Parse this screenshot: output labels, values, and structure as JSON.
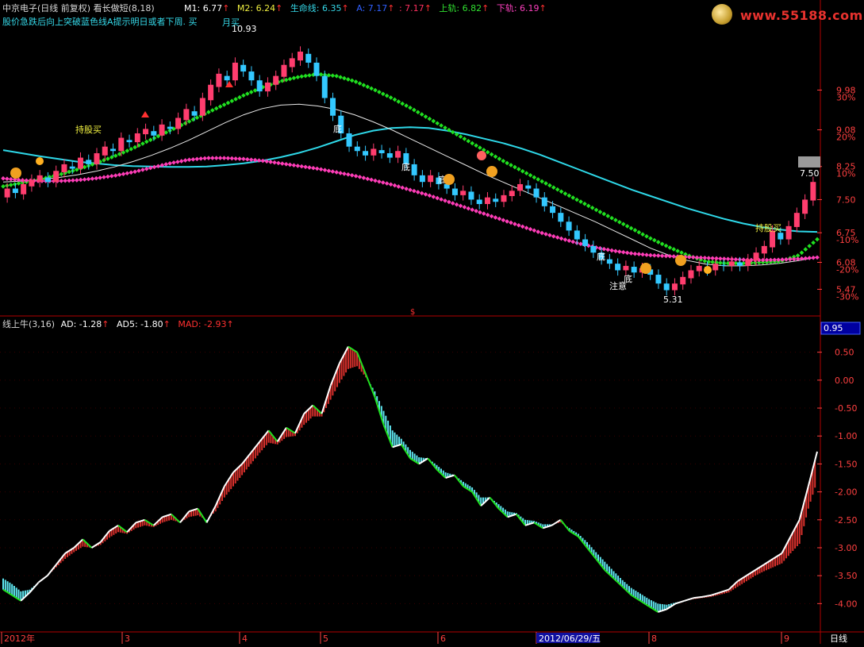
{
  "header": {
    "stock_title": "中京电子(日线 前复权)",
    "indicator_name": "看长做短(8,18)",
    "m1": "M1: 6.77",
    "m2": "M2: 6.24",
    "lifeline": "生命线: 6.35",
    "a_line": "A: 7.17",
    "b_line": ": 7.17",
    "upper": "上轨: 6.82",
    "lower": "下轨: 6.19",
    "hint": "股价急跌后向上突破蓝色线A提示明日或者下周.",
    "hint_tag": "买"
  },
  "lower_header": {
    "name": "线上牛(3,16)",
    "ad": "AD: -1.28",
    "ad5": "AD5: -1.80",
    "mad": "MAD: -2.93",
    "current_value": "0.95"
  },
  "watermark": {
    "text": "www.55188.com"
  },
  "colors": {
    "candle_up": "#ff3d6e",
    "candle_down": "#33c8ff",
    "ma_cyan": "#2ed8e8",
    "ma_white": "#e8e8e8",
    "dots_green": "#20e020",
    "dots_pink": "#ff3db8",
    "red": "#d8302c",
    "cyan_bar": "#5ee6f0",
    "axis": "#b00000",
    "tick": "#ff4040"
  },
  "chart_data": [
    {
      "type": "candlestick",
      "yaxis": {
        "price_ticks": [
          "9.98",
          "9.08",
          "8.25",
          "7.50",
          "6.75",
          "6.08",
          "5.47"
        ],
        "pct_ticks": [
          "30%",
          "20%",
          "10%",
          "-10%",
          "-20%",
          "-30%"
        ],
        "ylim": [
          5.1,
          11.3
        ]
      },
      "annotations": {
        "high": "10.93",
        "low": "5.31",
        "last": "7.50",
        "bottom_marks": [
          "底",
          "底",
          "底",
          "底",
          "底"
        ],
        "attention": "注意",
        "buy_left": "持股买",
        "buy_right": "持股买",
        "month_buy": "月买"
      },
      "x_months": [
        "2012年",
        "3",
        "4",
        "5",
        "6",
        "2012/06/29/五",
        "8",
        "9"
      ],
      "candles": [
        {
          "o": 7.55,
          "c": 7.75
        },
        {
          "o": 7.75,
          "c": 7.65
        },
        {
          "o": 7.62,
          "c": 7.85
        },
        {
          "o": 7.8,
          "c": 7.95
        },
        {
          "o": 7.9,
          "c": 8.05
        },
        {
          "o": 8.0,
          "c": 7.9
        },
        {
          "o": 7.9,
          "c": 8.15
        },
        {
          "o": 8.12,
          "c": 8.3
        },
        {
          "o": 8.25,
          "c": 8.2
        },
        {
          "o": 8.2,
          "c": 8.45
        },
        {
          "o": 8.4,
          "c": 8.3
        },
        {
          "o": 8.3,
          "c": 8.55
        },
        {
          "o": 8.5,
          "c": 8.7
        },
        {
          "o": 8.65,
          "c": 8.6
        },
        {
          "o": 8.6,
          "c": 8.9
        },
        {
          "o": 8.85,
          "c": 8.8
        },
        {
          "o": 8.8,
          "c": 9.0
        },
        {
          "o": 8.98,
          "c": 9.1
        },
        {
          "o": 9.05,
          "c": 8.95
        },
        {
          "o": 8.95,
          "c": 9.2
        },
        {
          "o": 9.15,
          "c": 9.1
        },
        {
          "o": 9.1,
          "c": 9.35
        },
        {
          "o": 9.3,
          "c": 9.55
        },
        {
          "o": 9.5,
          "c": 9.4
        },
        {
          "o": 9.4,
          "c": 9.8
        },
        {
          "o": 9.75,
          "c": 10.1
        },
        {
          "o": 10.05,
          "c": 10.35
        },
        {
          "o": 10.3,
          "c": 10.2
        },
        {
          "o": 10.2,
          "c": 10.6
        },
        {
          "o": 10.55,
          "c": 10.4
        },
        {
          "o": 10.4,
          "c": 10.2
        },
        {
          "o": 10.2,
          "c": 9.95
        },
        {
          "o": 9.95,
          "c": 10.15
        },
        {
          "o": 10.1,
          "c": 10.3
        },
        {
          "o": 10.28,
          "c": 10.55
        },
        {
          "o": 10.5,
          "c": 10.7
        },
        {
          "o": 10.65,
          "c": 10.85
        },
        {
          "o": 10.8,
          "c": 10.6
        },
        {
          "o": 10.6,
          "c": 10.3
        },
        {
          "o": 10.3,
          "c": 9.8
        },
        {
          "o": 9.8,
          "c": 9.4
        },
        {
          "o": 9.4,
          "c": 9.0
        },
        {
          "o": 9.0,
          "c": 8.7
        },
        {
          "o": 8.7,
          "c": 8.6
        },
        {
          "o": 8.6,
          "c": 8.5
        },
        {
          "o": 8.5,
          "c": 8.65
        },
        {
          "o": 8.62,
          "c": 8.55
        },
        {
          "o": 8.55,
          "c": 8.45
        },
        {
          "o": 8.45,
          "c": 8.6
        },
        {
          "o": 8.55,
          "c": 8.3
        },
        {
          "o": 8.3,
          "c": 8.05
        },
        {
          "o": 8.05,
          "c": 7.9
        },
        {
          "o": 7.9,
          "c": 8.05
        },
        {
          "o": 8.0,
          "c": 7.85
        },
        {
          "o": 7.85,
          "c": 7.75
        },
        {
          "o": 7.75,
          "c": 7.6
        },
        {
          "o": 7.6,
          "c": 7.7
        },
        {
          "o": 7.68,
          "c": 7.5
        },
        {
          "o": 7.5,
          "c": 7.4
        },
        {
          "o": 7.4,
          "c": 7.55
        },
        {
          "o": 7.52,
          "c": 7.45
        },
        {
          "o": 7.45,
          "c": 7.6
        },
        {
          "o": 7.58,
          "c": 7.7
        },
        {
          "o": 7.7,
          "c": 7.85
        },
        {
          "o": 7.82,
          "c": 7.75
        },
        {
          "o": 7.75,
          "c": 7.55
        },
        {
          "o": 7.55,
          "c": 7.35
        },
        {
          "o": 7.35,
          "c": 7.2
        },
        {
          "o": 7.2,
          "c": 7.0
        },
        {
          "o": 7.0,
          "c": 6.8
        },
        {
          "o": 6.8,
          "c": 6.6
        },
        {
          "o": 6.6,
          "c": 6.45
        },
        {
          "o": 6.45,
          "c": 6.3
        },
        {
          "o": 6.3,
          "c": 6.15
        },
        {
          "o": 6.15,
          "c": 6.05
        },
        {
          "o": 6.05,
          "c": 5.9
        },
        {
          "o": 5.9,
          "c": 6.0
        },
        {
          "o": 5.98,
          "c": 5.85
        },
        {
          "o": 5.85,
          "c": 5.95
        },
        {
          "o": 5.92,
          "c": 5.8
        },
        {
          "o": 5.8,
          "c": 5.6
        },
        {
          "o": 5.6,
          "c": 5.45
        },
        {
          "o": 5.45,
          "c": 5.6
        },
        {
          "o": 5.58,
          "c": 5.75
        },
        {
          "o": 5.72,
          "c": 5.9
        },
        {
          "o": 5.88,
          "c": 6.0
        },
        {
          "o": 5.98,
          "c": 5.9
        },
        {
          "o": 5.9,
          "c": 6.05
        },
        {
          "o": 6.02,
          "c": 6.0
        },
        {
          "o": 6.0,
          "c": 6.1
        },
        {
          "o": 6.08,
          "c": 6.0
        },
        {
          "o": 6.0,
          "c": 6.15
        },
        {
          "o": 6.12,
          "c": 6.3
        },
        {
          "o": 6.28,
          "c": 6.45
        },
        {
          "o": 6.42,
          "c": 6.8
        },
        {
          "o": 6.75,
          "c": 6.6
        },
        {
          "o": 6.6,
          "c": 6.9
        },
        {
          "o": 6.88,
          "c": 7.2
        },
        {
          "o": 7.18,
          "c": 7.5
        },
        {
          "o": 7.48,
          "c": 7.9
        }
      ],
      "ma_cyan": [
        8.62,
        8.55,
        8.48,
        8.42,
        8.36,
        8.32,
        8.28,
        8.26,
        8.25,
        8.24,
        8.24,
        8.25,
        8.28,
        8.32,
        8.38,
        8.46,
        8.56,
        8.68,
        8.82,
        8.96,
        9.06,
        9.12,
        9.14,
        9.12,
        9.06,
        8.98,
        8.88,
        8.78,
        8.66,
        8.52,
        8.36,
        8.2,
        8.04,
        7.88,
        7.72,
        7.58,
        7.44,
        7.3,
        7.18,
        7.06,
        6.96,
        6.88,
        6.82,
        6.78,
        6.77
      ],
      "ma_white": [
        7.9,
        7.92,
        7.95,
        8.0,
        8.06,
        8.14,
        8.24,
        8.36,
        8.5,
        8.66,
        8.84,
        9.04,
        9.24,
        9.42,
        9.56,
        9.64,
        9.66,
        9.62,
        9.54,
        9.42,
        9.26,
        9.08,
        8.88,
        8.68,
        8.48,
        8.28,
        8.08,
        7.9,
        7.72,
        7.54,
        7.36,
        7.18,
        7.0,
        6.8,
        6.6,
        6.4,
        6.24,
        6.12,
        6.04,
        6.0,
        6.0,
        6.02,
        6.06,
        6.12,
        6.2
      ],
      "dots_green": [
        7.8,
        7.88,
        7.96,
        8.06,
        8.18,
        8.32,
        8.48,
        8.66,
        8.86,
        9.06,
        9.26,
        9.46,
        9.66,
        9.86,
        10.04,
        10.18,
        10.28,
        10.34,
        10.3,
        10.18,
        10.0,
        9.8,
        9.58,
        9.34,
        9.1,
        8.86,
        8.62,
        8.38,
        8.16,
        7.94,
        7.72,
        7.5,
        7.28,
        7.06,
        6.84,
        6.62,
        6.42,
        6.24,
        6.1,
        6.06,
        6.06,
        6.08,
        6.1,
        6.24,
        6.6
      ],
      "dots_pink": [
        7.98,
        7.94,
        7.92,
        7.92,
        7.94,
        7.98,
        8.04,
        8.12,
        8.22,
        8.32,
        8.4,
        8.44,
        8.44,
        8.42,
        8.38,
        8.32,
        8.26,
        8.2,
        8.12,
        8.04,
        7.94,
        7.84,
        7.72,
        7.6,
        7.46,
        7.32,
        7.18,
        7.04,
        6.9,
        6.76,
        6.64,
        6.52,
        6.42,
        6.34,
        6.28,
        6.24,
        6.22,
        6.2,
        6.18,
        6.16,
        6.14,
        6.13,
        6.14,
        6.16,
        6.19
      ]
    },
    {
      "type": "bar",
      "title": "线上牛(3,16)",
      "yaxis": {
        "ticks": [
          "0.50",
          "0.00",
          "-0.50",
          "-1.00",
          "-1.50",
          "-2.00",
          "-2.50",
          "-3.00",
          "-3.50",
          "-4.00"
        ],
        "ylim": [
          -4.45,
          0.95
        ]
      },
      "series_ad": [
        -3.75,
        -3.85,
        -3.95,
        -3.8,
        -3.62,
        -3.5,
        -3.3,
        -3.1,
        -3.0,
        -2.85,
        -3.0,
        -2.9,
        -2.7,
        -2.6,
        -2.72,
        -2.55,
        -2.5,
        -2.6,
        -2.45,
        -2.4,
        -2.55,
        -2.35,
        -2.3,
        -2.55,
        -2.25,
        -1.9,
        -1.65,
        -1.5,
        -1.3,
        -1.1,
        -0.9,
        -1.1,
        -0.85,
        -0.95,
        -0.6,
        -0.45,
        -0.6,
        -0.1,
        0.3,
        0.6,
        0.5,
        0.1,
        -0.3,
        -0.8,
        -1.2,
        -1.15,
        -1.4,
        -1.5,
        -1.4,
        -1.6,
        -1.75,
        -1.7,
        -1.9,
        -2.0,
        -2.25,
        -2.1,
        -2.3,
        -2.45,
        -2.4,
        -2.6,
        -2.55,
        -2.65,
        -2.6,
        -2.5,
        -2.7,
        -2.8,
        -3.0,
        -3.2,
        -3.4,
        -3.55,
        -3.7,
        -3.85,
        -3.95,
        -4.05,
        -4.15,
        -4.1,
        -4.0,
        -3.95,
        -3.9,
        -3.88,
        -3.85,
        -3.8,
        -3.75,
        -3.6,
        -3.5,
        -3.4,
        -3.3,
        -3.2,
        -3.1,
        -2.8,
        -2.5,
        -1.9,
        -1.28
      ],
      "series_mad": [
        -3.55,
        -3.65,
        -3.78,
        -3.75,
        -3.62,
        -3.5,
        -3.35,
        -3.2,
        -3.08,
        -2.98,
        -3.0,
        -2.95,
        -2.82,
        -2.72,
        -2.75,
        -2.65,
        -2.6,
        -2.63,
        -2.55,
        -2.5,
        -2.55,
        -2.45,
        -2.42,
        -2.5,
        -2.35,
        -2.1,
        -1.9,
        -1.7,
        -1.5,
        -1.3,
        -1.12,
        -1.15,
        -1.02,
        -1.0,
        -0.8,
        -0.65,
        -0.65,
        -0.35,
        -0.05,
        0.2,
        0.25,
        0.05,
        -0.2,
        -0.55,
        -0.9,
        -1.05,
        -1.25,
        -1.38,
        -1.4,
        -1.52,
        -1.65,
        -1.7,
        -1.82,
        -1.92,
        -2.1,
        -2.1,
        -2.22,
        -2.35,
        -2.38,
        -2.5,
        -2.52,
        -2.58,
        -2.58,
        -2.55,
        -2.65,
        -2.75,
        -2.9,
        -3.08,
        -3.25,
        -3.42,
        -3.58,
        -3.72,
        -3.82,
        -3.92,
        -4.0,
        -4.02,
        -3.98,
        -3.95,
        -3.92,
        -3.9,
        -3.88,
        -3.84,
        -3.8,
        -3.7,
        -3.6,
        -3.5,
        -3.42,
        -3.35,
        -3.28,
        -3.1,
        -2.93,
        -2.3,
        -1.8
      ]
    }
  ]
}
